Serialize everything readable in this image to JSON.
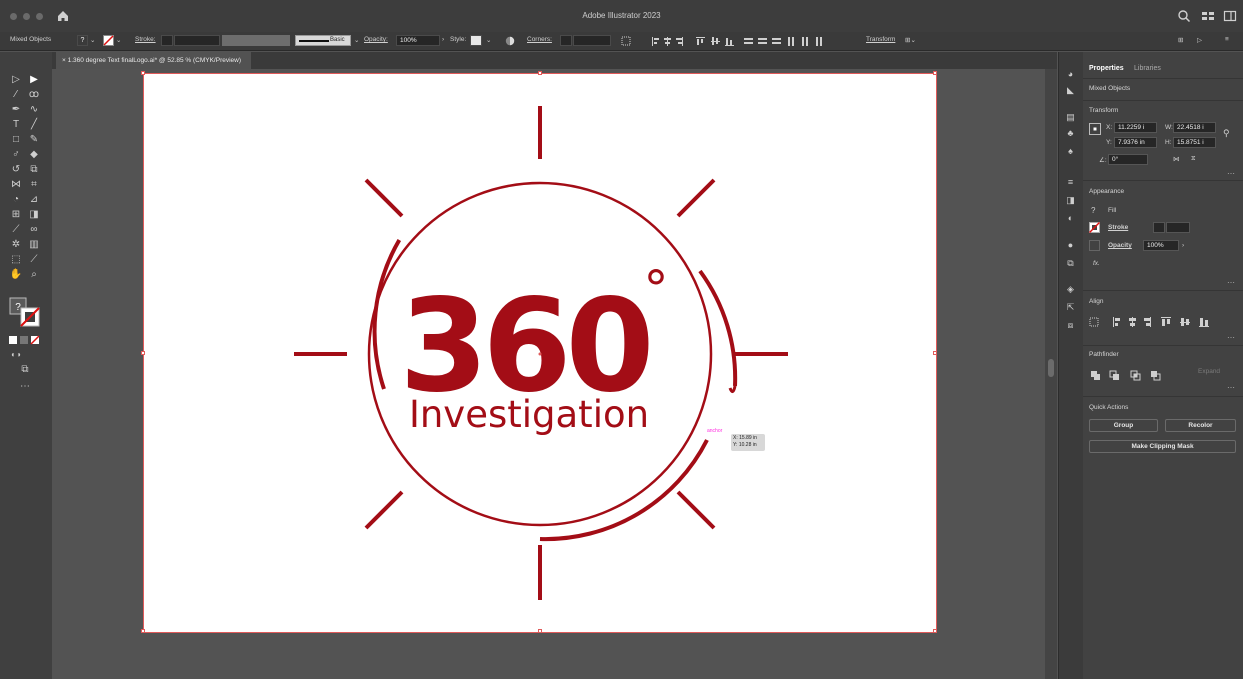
{
  "window": {
    "title": "Adobe Illustrator 2023"
  },
  "control_bar": {
    "selection": "Mixed Objects",
    "fill_value": "?",
    "stroke_label": "Stroke:",
    "brush_label": "Basic",
    "opacity_label": "Opacity:",
    "opacity_value": "100%",
    "style_label": "Style:",
    "corners_label": "Corners:",
    "transform_label": "Transform"
  },
  "document_tab": {
    "label": "1.360 degree Text finalLogo.ai* @ 52.85 % (CMYK/Preview)"
  },
  "artwork": {
    "number": "360",
    "degree_mark": "°",
    "word": "Investigation",
    "brand_color": "#a30d16"
  },
  "cursor_tooltip": {
    "anchor": "anchor",
    "x": "X: 15.89 in",
    "y": "Y: 10.28 in"
  },
  "panel": {
    "tabs": [
      "Properties",
      "Libraries"
    ],
    "selection_label": "Mixed Objects",
    "transform": {
      "title": "Transform",
      "x_label": "X:",
      "x_value": "11.2259 i",
      "y_label": "Y:",
      "y_value": "7.9376 in",
      "w_label": "W:",
      "w_value": "22.4518 i",
      "h_label": "H:",
      "h_value": "15.8751 i",
      "angle_label": "∠:",
      "angle_value": "0°"
    },
    "appearance": {
      "title": "Appearance",
      "fill_value": "?",
      "fill_label": "Fill",
      "stroke_label": "Stroke",
      "opacity_label": "Opacity",
      "opacity_value": "100%",
      "fx_label": "fx."
    },
    "align": {
      "title": "Align"
    },
    "pathfinder": {
      "title": "Pathfinder",
      "expand_label": "Expand"
    },
    "quick_actions": {
      "title": "Quick Actions",
      "group_label": "Group",
      "recolor_label": "Recolor",
      "clipping_label": "Make Clipping Mask"
    }
  },
  "colors": {
    "accent": "#a30d16",
    "selection": "#e05a5a",
    "panel_bg": "#424242"
  }
}
